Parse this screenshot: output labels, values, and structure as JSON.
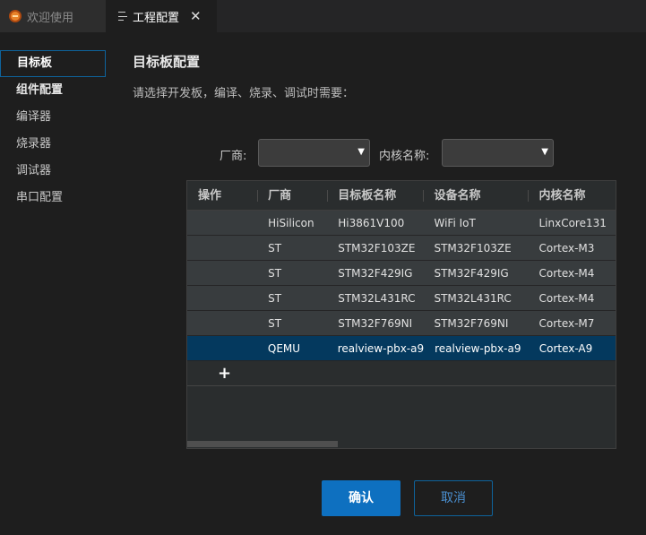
{
  "tabs": [
    {
      "label": "欢迎使用",
      "icon": "deveco-logo-icon",
      "active": false
    },
    {
      "label": "工程配置",
      "icon": "document-lines-icon",
      "active": true,
      "close": "✕"
    }
  ],
  "sidebar": {
    "items": [
      {
        "label": "目标板",
        "selected": true
      },
      {
        "label": "组件配置"
      },
      {
        "label": "编译器"
      },
      {
        "label": "烧录器"
      },
      {
        "label": "调试器"
      },
      {
        "label": "串口配置"
      }
    ]
  },
  "main": {
    "title": "目标板配置",
    "subtitle": "请选择开发板，编译、烧录、调试时需要：",
    "filters": {
      "vendor_label": "厂商:",
      "vendor_value": "",
      "core_label": "内核名称:",
      "core_value": "",
      "arrow": "▼"
    },
    "table": {
      "headers": [
        "操作",
        "厂商",
        "目标板名称",
        "设备名称",
        "内核名称"
      ],
      "rows": [
        [
          "",
          "HiSilicon",
          "Hi3861V100",
          "WiFi IoT",
          "LinxCore131"
        ],
        [
          "",
          "ST",
          "STM32F103ZE",
          "STM32F103ZE",
          "Cortex-M3"
        ],
        [
          "",
          "ST",
          "STM32F429IG",
          "STM32F429IG",
          "Cortex-M4"
        ],
        [
          "",
          "ST",
          "STM32L431RC",
          "STM32L431RC",
          "Cortex-M4"
        ],
        [
          "",
          "ST",
          "STM32F769NI",
          "STM32F769NI",
          "Cortex-M7"
        ],
        [
          "",
          "QEMU",
          "realview-pbx-a9",
          "realview-pbx-a9",
          "Cortex-A9"
        ]
      ],
      "selected_row": 5,
      "add_label": "+"
    },
    "buttons": {
      "confirm": "确认",
      "cancel": "取消"
    }
  },
  "colors": {
    "accent": "#0e70c0",
    "selected_row": "#04395e",
    "background": "#1e1e1e"
  }
}
